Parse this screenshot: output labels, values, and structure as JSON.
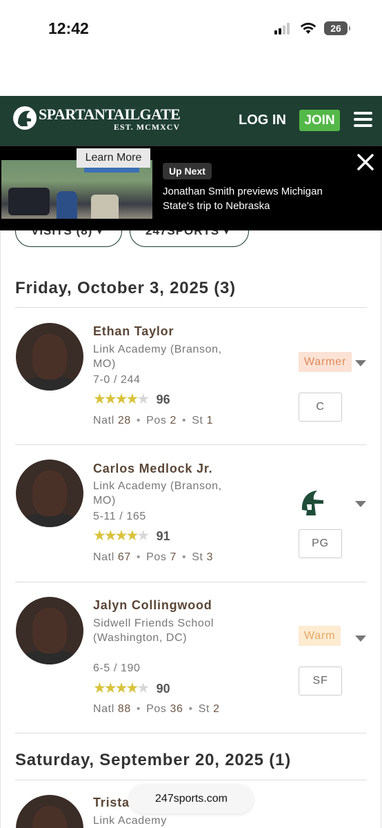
{
  "status_bar": {
    "time": "12:42",
    "battery": "26"
  },
  "header": {
    "logo_title": "SPARTANTAILGATE",
    "logo_subtitle": "EST. MCMXCV",
    "login_label": "LOG IN",
    "join_label": "JOIN",
    "bg_color": "#1f3f33",
    "join_color": "#54b848"
  },
  "video_banner": {
    "learn_more": "Learn More",
    "up_next": "Up Next",
    "title": "Jonathan Smith previews Michigan State's trip to Nebraska"
  },
  "filters": [
    {
      "label": "VISITS (8)"
    },
    {
      "label": "247SPORTS"
    }
  ],
  "sections": [
    {
      "date": "Friday, October 3, 2025 (3)"
    },
    {
      "date": "Saturday, September 20, 2025 (1)"
    }
  ],
  "players": [
    {
      "name": "Ethan Taylor",
      "school": "Link Academy (Branson, MO)",
      "measurements": "7-0 / 244",
      "stars": 4,
      "rating": "96",
      "natl_label": "Natl",
      "natl": "28",
      "pos_label": "Pos",
      "pos_rank": "2",
      "st_label": "St",
      "st": "1",
      "status": "Warmer",
      "position": "C"
    },
    {
      "name": "Carlos Medlock Jr.",
      "school": "Link Academy (Branson, MO)",
      "measurements": "5-11 / 165",
      "stars": 4,
      "rating": "91",
      "natl_label": "Natl",
      "natl": "67",
      "pos_label": "Pos",
      "pos_rank": "7",
      "st_label": "St",
      "st": "3",
      "status_icon": "spartan-helmet-icon",
      "position": "PG"
    },
    {
      "name": "Jalyn Collingwood",
      "school": "Sidwell Friends School (Washington, DC)",
      "measurements": "6-5 / 190",
      "stars": 4,
      "rating": "90",
      "natl_label": "Natl",
      "natl": "88",
      "pos_label": "Pos",
      "pos_rank": "36",
      "st_label": "St",
      "st": "2",
      "status": "Warm",
      "position": "SF"
    },
    {
      "name": "Trista",
      "school": "Link Academy"
    }
  ],
  "url_bar": {
    "text": "247sports.com"
  }
}
